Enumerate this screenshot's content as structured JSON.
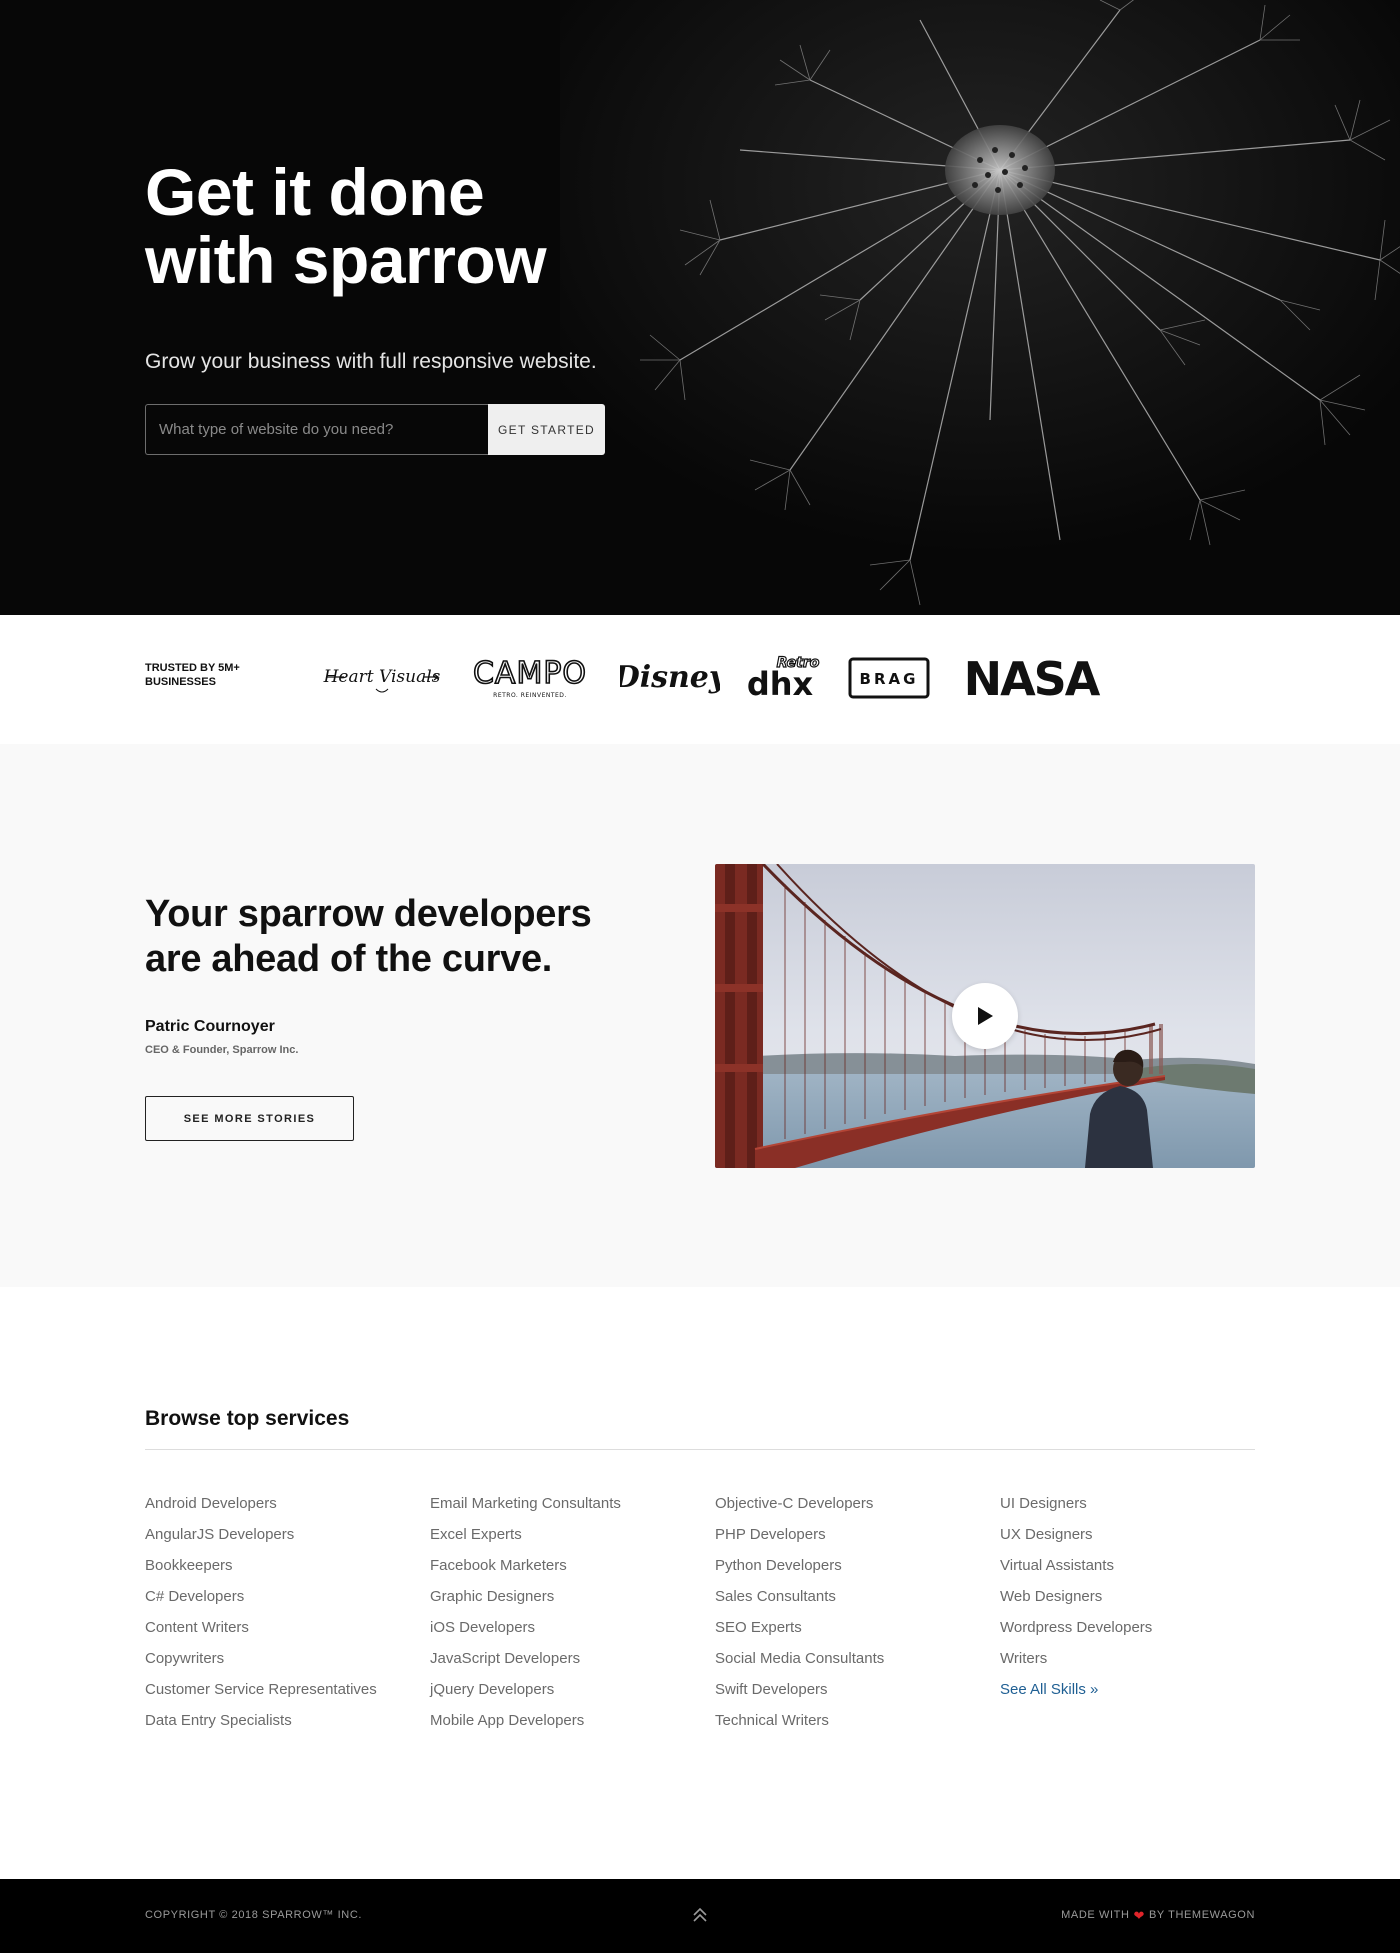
{
  "hero": {
    "title_line1": "Get it done",
    "title_line2": "with sparrow",
    "subtitle": "Grow your business with full responsive website.",
    "search_placeholder": "What type of website do you need?",
    "button_label": "GET STARTED"
  },
  "trusted": {
    "label_line1": "TRUSTED BY 5M+",
    "label_line2": "BUSINESSES",
    "logos": [
      "HeartVisuals",
      "CAMPO",
      "Disney",
      "dhx Retro",
      "BRAG",
      "NASA"
    ],
    "campo_text": "CAMPO",
    "campo_tagline": "RETRO. REINVENTED.",
    "heart_visuals_text": "Heart Visuals",
    "disney_text": "Disney",
    "dhx_text": "dhx",
    "retro_text": "Retro",
    "brag_text": "BRAG",
    "nasa_text": "NASA"
  },
  "story": {
    "title_line1": "Your sparrow developers",
    "title_line2": "are ahead of the curve.",
    "person_name": "Patric Cournoyer",
    "person_role": "CEO & Founder, Sparrow Inc.",
    "button_label": "SEE MORE STORIES"
  },
  "services": {
    "title": "Browse top services",
    "columns": [
      [
        "Android Developers",
        "AngularJS Developers",
        "Bookkeepers",
        "C# Developers",
        "Content Writers",
        "Copywriters",
        "Customer Service Representatives",
        "Data Entry Specialists"
      ],
      [
        "Email Marketing Consultants",
        "Excel Experts",
        "Facebook Marketers",
        "Graphic Designers",
        "iOS Developers",
        "JavaScript Developers",
        "jQuery Developers",
        "Mobile App Developers"
      ],
      [
        "Objective-C Developers",
        "PHP Developers",
        "Python Developers",
        "Sales Consultants",
        "SEO Experts",
        "Social Media Consultants",
        "Swift Developers",
        "Technical Writers"
      ],
      [
        "UI Designers",
        "UX Designers",
        "Virtual Assistants",
        "Web Designers",
        "Wordpress Developers",
        "Writers"
      ]
    ],
    "see_all_label": "See All Skills »",
    "link_color": "#1f5f93"
  },
  "footer": {
    "copyright": "COPYRIGHT © 2018 SPARROW™ INC.",
    "made_with": "MADE WITH",
    "by": "BY THEMEWAGON",
    "heart_color": "#e0242a"
  }
}
